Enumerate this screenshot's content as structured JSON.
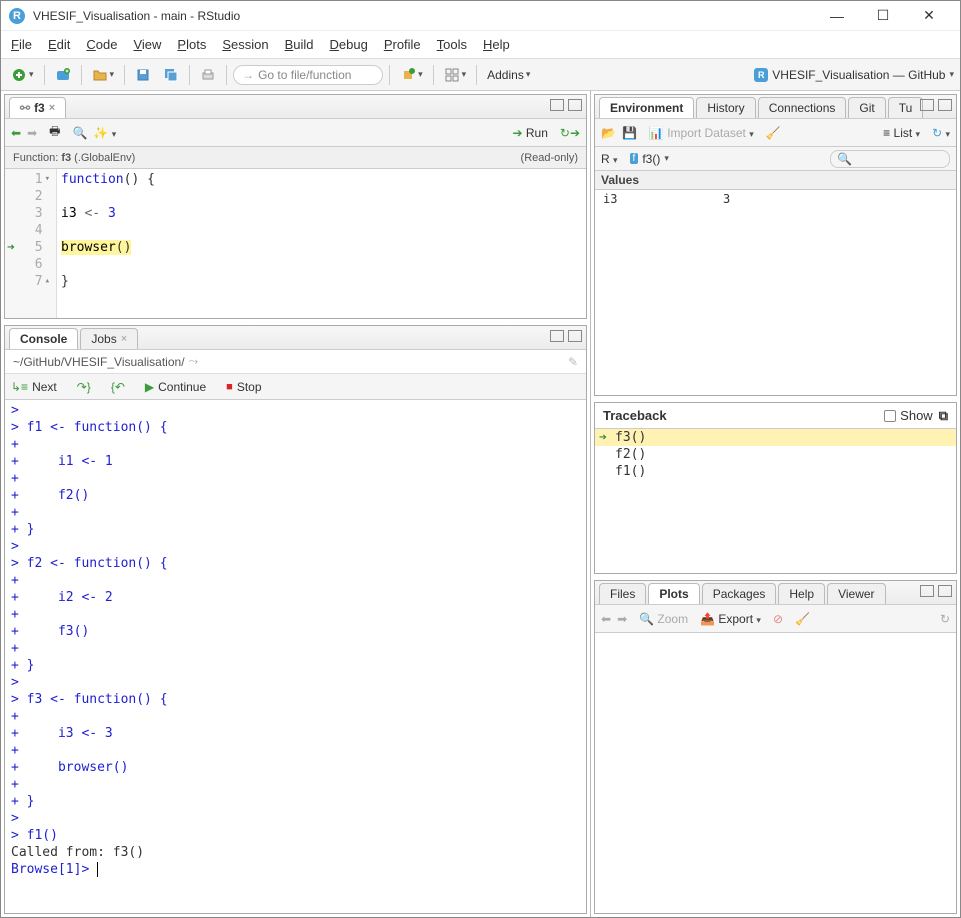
{
  "window": {
    "title": "VHESIF_Visualisation - main - RStudio"
  },
  "menu": [
    "File",
    "Edit",
    "Code",
    "View",
    "Plots",
    "Session",
    "Build",
    "Debug",
    "Profile",
    "Tools",
    "Help"
  ],
  "toolbar": {
    "goto_placeholder": "Go to file/function",
    "addins": "Addins",
    "project": "VHESIF_Visualisation — GitHub"
  },
  "source": {
    "tab_name": "f3",
    "run": "Run",
    "fn_label": "Function:",
    "fn_name": "f3",
    "fn_env": "(.GlobalEnv)",
    "readonly": "(Read-only)",
    "lines": [
      {
        "n": "1",
        "text": "function() {",
        "fold": "▾"
      },
      {
        "n": "2",
        "text": ""
      },
      {
        "n": "3",
        "text": "    i3 <- 3"
      },
      {
        "n": "4",
        "text": ""
      },
      {
        "n": "5",
        "text": "    browser()",
        "hl": true,
        "arrow": true
      },
      {
        "n": "6",
        "text": ""
      },
      {
        "n": "7",
        "text": "}",
        "fold": "▴"
      }
    ]
  },
  "console": {
    "tabs": [
      "Console",
      "Jobs"
    ],
    "path": "~/GitHub/VHESIF_Visualisation/",
    "debug": {
      "next": "Next",
      "continue": "Continue",
      "stop": "Stop"
    },
    "lines": [
      ">",
      "> f1 <- function() {",
      "+ ",
      "+     i1 <- 1",
      "+ ",
      "+     f2()",
      "+ ",
      "+ }",
      "> ",
      "> f2 <- function() {",
      "+ ",
      "+     i2 <- 2",
      "+ ",
      "+     f3()",
      "+ ",
      "+ }",
      "> ",
      "> f3 <- function() {",
      "+ ",
      "+     i3 <- 3",
      "+ ",
      "+     browser()",
      "+ ",
      "+ }",
      "> ",
      "> f1()"
    ],
    "called_from": "Called from: f3()",
    "prompt": "Browse[1]> "
  },
  "env": {
    "tabs": [
      "Environment",
      "History",
      "Connections",
      "Git",
      "Tu"
    ],
    "import": "Import Dataset",
    "list": "List",
    "scope_r": "R",
    "scope_fn": "f3()",
    "section": "Values",
    "rows": [
      {
        "name": "i3",
        "value": "3"
      }
    ]
  },
  "trace": {
    "title": "Traceback",
    "show": "Show",
    "frames": [
      "f3()",
      "f2()",
      "f1()"
    ]
  },
  "plots": {
    "tabs": [
      "Files",
      "Plots",
      "Packages",
      "Help",
      "Viewer"
    ],
    "zoom": "Zoom",
    "export": "Export"
  }
}
